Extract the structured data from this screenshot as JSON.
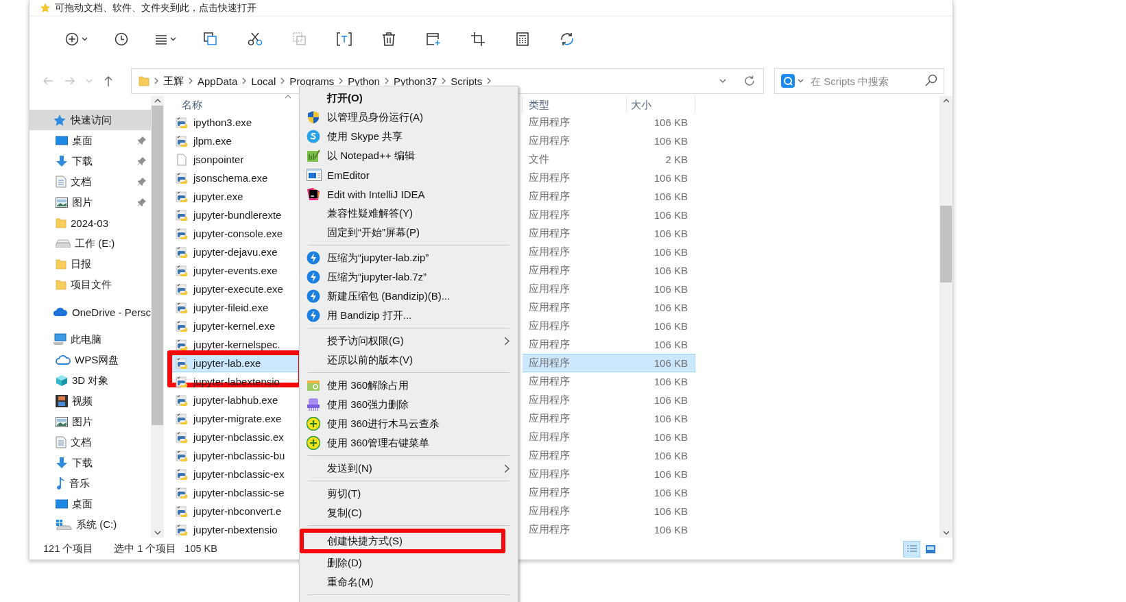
{
  "hint_bar": {
    "text": "可拖动文档、软件、文件夹到此，点击快速打开"
  },
  "toolbar": [
    {
      "dropdown": true,
      "disabled": false
    },
    {
      "dropdown": false,
      "disabled": false
    },
    {
      "dropdown": true,
      "disabled": false
    },
    {
      "dropdown": false,
      "disabled": false
    },
    {
      "dropdown": false,
      "disabled": false
    },
    {
      "dropdown": false,
      "disabled": true
    },
    {
      "dropdown": false,
      "disabled": false
    },
    {
      "dropdown": false,
      "disabled": false
    },
    {
      "dropdown": false,
      "disabled": false
    },
    {
      "dropdown": false,
      "disabled": false
    },
    {
      "dropdown": false,
      "disabled": false
    },
    {
      "dropdown": false,
      "disabled": false
    }
  ],
  "address_bar": {
    "path": [
      "王辉",
      "AppData",
      "Local",
      "Programs",
      "Python",
      "Python37",
      "Scripts"
    ]
  },
  "search": {
    "placeholder": "在 Scripts 中搜索"
  },
  "navigation": [
    {
      "label": "快速访问",
      "selected": true,
      "children": [
        {
          "label": "桌面",
          "pinned": true
        },
        {
          "label": "下载",
          "pinned": true
        },
        {
          "label": "文档",
          "pinned": true
        },
        {
          "label": "图片",
          "pinned": true
        },
        {
          "label": "2024-03",
          "pinned": false
        },
        {
          "label": "工作 (E:)",
          "pinned": false
        },
        {
          "label": "日报",
          "pinned": false
        },
        {
          "label": "项目文件",
          "pinned": false
        }
      ]
    },
    {
      "label": "OneDrive - Persc",
      "selected": false
    },
    {
      "label": "此电脑",
      "selected": false,
      "children": [
        {
          "label": "WPS网盘",
          "pinned": false
        },
        {
          "label": "3D 对象",
          "pinned": false
        },
        {
          "label": "视频",
          "pinned": false
        },
        {
          "label": "图片",
          "pinned": false
        },
        {
          "label": "文档",
          "pinned": false
        },
        {
          "label": "下载",
          "pinned": false
        },
        {
          "label": "音乐",
          "pinned": false
        },
        {
          "label": "桌面",
          "pinned": false
        },
        {
          "label": "系统 (C:)",
          "pinned": false
        }
      ]
    }
  ],
  "file_list": {
    "columns": [
      "名称",
      "类型",
      "大小"
    ],
    "rows": [
      {
        "name": "ipython3.exe",
        "type": "应用程序",
        "size": "106 KB",
        "selected": false,
        "highlighted": false
      },
      {
        "name": "jlpm.exe",
        "type": "应用程序",
        "size": "106 KB",
        "selected": false,
        "highlighted": false
      },
      {
        "name": "jsonpointer",
        "type": "文件",
        "size": "2 KB",
        "selected": false,
        "highlighted": false
      },
      {
        "name": "jsonschema.exe",
        "type": "应用程序",
        "size": "106 KB",
        "selected": false,
        "highlighted": false
      },
      {
        "name": "jupyter.exe",
        "type": "应用程序",
        "size": "106 KB",
        "selected": false,
        "highlighted": false
      },
      {
        "name": "jupyter-bundlerexte",
        "type": "应用程序",
        "size": "106 KB",
        "selected": false,
        "highlighted": false
      },
      {
        "name": "jupyter-console.exe",
        "type": "应用程序",
        "size": "106 KB",
        "selected": false,
        "highlighted": false
      },
      {
        "name": "jupyter-dejavu.exe",
        "type": "应用程序",
        "size": "106 KB",
        "selected": false,
        "highlighted": false
      },
      {
        "name": "jupyter-events.exe",
        "type": "应用程序",
        "size": "106 KB",
        "selected": false,
        "highlighted": false
      },
      {
        "name": "jupyter-execute.exe",
        "type": "应用程序",
        "size": "106 KB",
        "selected": false,
        "highlighted": false
      },
      {
        "name": "jupyter-fileid.exe",
        "type": "应用程序",
        "size": "106 KB",
        "selected": false,
        "highlighted": false
      },
      {
        "name": "jupyter-kernel.exe",
        "type": "应用程序",
        "size": "106 KB",
        "selected": false,
        "highlighted": false
      },
      {
        "name": "jupyter-kernelspec.",
        "type": "应用程序",
        "size": "106 KB",
        "selected": false,
        "highlighted": false
      },
      {
        "name": "jupyter-lab.exe",
        "type": "应用程序",
        "size": "106 KB",
        "selected": true,
        "highlighted": true
      },
      {
        "name": "jupyter-labextensio",
        "type": "应用程序",
        "size": "106 KB",
        "selected": false,
        "highlighted": false
      },
      {
        "name": "jupyter-labhub.exe",
        "type": "应用程序",
        "size": "106 KB",
        "selected": false,
        "highlighted": false
      },
      {
        "name": "jupyter-migrate.exe",
        "type": "应用程序",
        "size": "106 KB",
        "selected": false,
        "highlighted": false
      },
      {
        "name": "jupyter-nbclassic.ex",
        "type": "应用程序",
        "size": "106 KB",
        "selected": false,
        "highlighted": false
      },
      {
        "name": "jupyter-nbclassic-bu",
        "type": "应用程序",
        "size": "106 KB",
        "selected": false,
        "highlighted": false
      },
      {
        "name": "jupyter-nbclassic-ex",
        "type": "应用程序",
        "size": "106 KB",
        "selected": false,
        "highlighted": false
      },
      {
        "name": "jupyter-nbclassic-se",
        "type": "应用程序",
        "size": "106 KB",
        "selected": false,
        "highlighted": false
      },
      {
        "name": "jupyter-nbconvert.e",
        "type": "应用程序",
        "size": "106 KB",
        "selected": false,
        "highlighted": false
      },
      {
        "name": "jupyter-nbextensio",
        "type": "应用程序",
        "size": "106 KB",
        "selected": false,
        "highlighted": false
      }
    ]
  },
  "status_bar": {
    "item_count": "121 个项目",
    "selection": "选中 1 个项目",
    "selection_size": "105 KB"
  },
  "view_buttons": [
    {
      "selected": true
    },
    {
      "selected": false
    }
  ],
  "context_menu": [
    {
      "kind": "item",
      "label": "打开(O)",
      "bold": true,
      "submenu": false,
      "highlighted": false
    },
    {
      "kind": "item",
      "label": "以管理员身份运行(A)",
      "bold": false,
      "submenu": false,
      "highlighted": false
    },
    {
      "kind": "item",
      "label": "使用 Skype 共享",
      "bold": false,
      "submenu": false,
      "highlighted": false
    },
    {
      "kind": "item",
      "label": "以 Notepad++ 编辑",
      "bold": false,
      "submenu": false,
      "highlighted": false
    },
    {
      "kind": "item",
      "label": "EmEditor",
      "bold": false,
      "submenu": false,
      "highlighted": false
    },
    {
      "kind": "item",
      "label": "Edit with IntelliJ IDEA",
      "bold": false,
      "submenu": false,
      "highlighted": false
    },
    {
      "kind": "item",
      "label": "兼容性疑难解答(Y)",
      "bold": false,
      "submenu": false,
      "highlighted": false
    },
    {
      "kind": "item",
      "label": "固定到“开始”屏幕(P)",
      "bold": false,
      "submenu": false,
      "highlighted": false
    },
    {
      "kind": "separator"
    },
    {
      "kind": "item",
      "label": "压缩为“jupyter-lab.zip”",
      "bold": false,
      "submenu": false,
      "highlighted": false
    },
    {
      "kind": "item",
      "label": "压缩为“jupyter-lab.7z”",
      "bold": false,
      "submenu": false,
      "highlighted": false
    },
    {
      "kind": "item",
      "label": "新建压缩包 (Bandizip)(B)...",
      "bold": false,
      "submenu": false,
      "highlighted": false
    },
    {
      "kind": "item",
      "label": "用 Bandizip 打开...",
      "bold": false,
      "submenu": false,
      "highlighted": false
    },
    {
      "kind": "separator"
    },
    {
      "kind": "item",
      "label": "授予访问权限(G)",
      "bold": false,
      "submenu": true,
      "highlighted": false
    },
    {
      "kind": "item",
      "label": "还原以前的版本(V)",
      "bold": false,
      "submenu": false,
      "highlighted": false
    },
    {
      "kind": "separator"
    },
    {
      "kind": "item",
      "label": "使用 360解除占用",
      "bold": false,
      "submenu": false,
      "highlighted": false
    },
    {
      "kind": "item",
      "label": "使用 360强力删除",
      "bold": false,
      "submenu": false,
      "highlighted": false
    },
    {
      "kind": "item",
      "label": "使用 360进行木马云查杀",
      "bold": false,
      "submenu": false,
      "highlighted": false
    },
    {
      "kind": "item",
      "label": "使用 360管理右键菜单",
      "bold": false,
      "submenu": false,
      "highlighted": false
    },
    {
      "kind": "separator"
    },
    {
      "kind": "item",
      "label": "发送到(N)",
      "bold": false,
      "submenu": true,
      "highlighted": false
    },
    {
      "kind": "separator"
    },
    {
      "kind": "item",
      "label": "剪切(T)",
      "bold": false,
      "submenu": false,
      "highlighted": false
    },
    {
      "kind": "item",
      "label": "复制(C)",
      "bold": false,
      "submenu": false,
      "highlighted": false
    },
    {
      "kind": "separator"
    },
    {
      "kind": "item",
      "label": "创建快捷方式(S)",
      "bold": false,
      "submenu": false,
      "highlighted": true
    },
    {
      "kind": "item",
      "label": "删除(D)",
      "bold": false,
      "submenu": false,
      "highlighted": false
    },
    {
      "kind": "item",
      "label": "重命名(M)",
      "bold": false,
      "submenu": false,
      "highlighted": false
    },
    {
      "kind": "separator"
    }
  ]
}
